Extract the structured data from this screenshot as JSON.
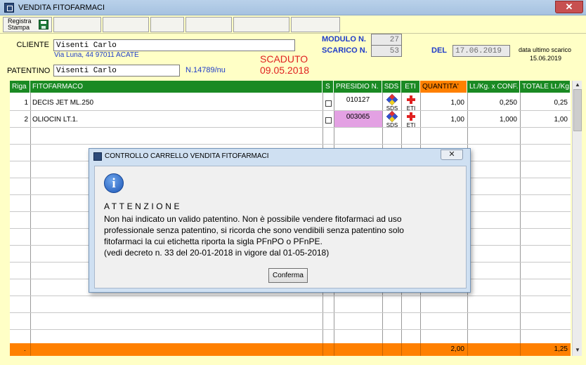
{
  "window": {
    "title": "VENDITA FITOFARMACI",
    "close_label": "✕"
  },
  "toolbar": {
    "save_label_line1": "Registra",
    "save_label_line2": "Stampa",
    "save_icon": "floppy-disk-icon"
  },
  "header": {
    "cliente_label": "CLIENTE",
    "cliente_value": "Visenti Carlo",
    "address": "Via Luna, 44 97011 ACATE",
    "patentino_label": "PATENTINO",
    "patentino_value": "Visenti Carlo",
    "patentino_number": "N.14789/nu",
    "status_line1": "SCADUTO",
    "status_line2": "09.05.2018",
    "modulo_label": "MODULO N.",
    "modulo_value": "27",
    "scarico_label": "SCARICO N.",
    "scarico_value": "53",
    "del_label": "DEL",
    "del_value": "17.06.2019",
    "last_unload_label": "data ultimo scarico",
    "last_unload_value": "15.06.2019"
  },
  "table": {
    "columns": [
      "Riga",
      "FITOFARMACO",
      "S",
      "PRESIDIO N.",
      "SDS",
      "ETI",
      "QUANTITA'",
      "Lt./Kg. x CONF.",
      "TOTALE Lt./Kg."
    ],
    "rows": [
      {
        "riga": "1",
        "fitofarmaco": "DECIS JET ML.250",
        "presidio": "010127",
        "sds": "SDS",
        "eti": "ETI",
        "quantita": "1,00",
        "lt_conf": "0,250",
        "totale": "0,25",
        "presidio_highlight": false
      },
      {
        "riga": "2",
        "fitofarmaco": "OLIOCIN LT.1.",
        "presidio": "003065",
        "sds": "SDS",
        "eti": "ETI",
        "quantita": "1,00",
        "lt_conf": "1,000",
        "totale": "1,00",
        "presidio_highlight": true
      }
    ],
    "totals": {
      "marker": ".",
      "quantita": "2,00",
      "totale": "1,25"
    }
  },
  "dialog": {
    "title": "CONTROLLO CARRELLO VENDITA FITOFARMACI",
    "close_label": "✕",
    "icon": "info-icon",
    "heading": "ATTENZIONE",
    "lines": [
      "Non hai indicato un valido patentino. Non è possibile vendere fitofarmaci ad uso",
      "professionale senza patentino, si ricorda che sono vendibili senza patentino solo",
      "fitofarmaci la cui etichetta riporta la sigla PFnPO o PFnPE.",
      "(vedi decreto n. 33 del 20-01-2018 in vigore dal 01-05-2018)"
    ],
    "confirm_label": "Conferma"
  },
  "colors": {
    "background": "#ffffc6",
    "header_green": "#1a8a23",
    "accent_orange": "#ff8000",
    "expired_red": "#e02020",
    "link_blue": "#1f3cc8",
    "highlight_pink": "#e3a1e3"
  }
}
